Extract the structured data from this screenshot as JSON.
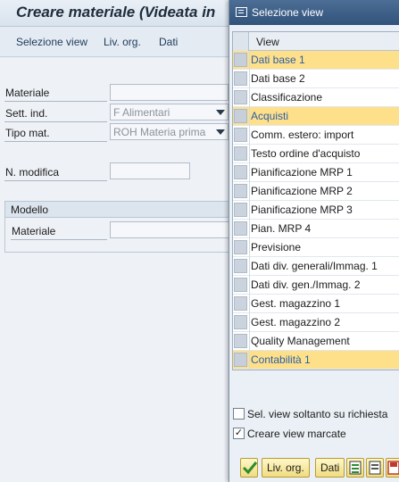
{
  "window": {
    "title": "Creare materiale (Videata in"
  },
  "menu": {
    "items": [
      "Selezione view",
      "Liv. org.",
      "Dati"
    ]
  },
  "form": {
    "materiale_label": "Materiale",
    "materiale_value": "",
    "sett_ind_label": "Sett. ind.",
    "sett_ind_value": "F Alimentari",
    "tipo_mat_label": "Tipo mat.",
    "tipo_mat_value": "ROH Materia prima",
    "n_modifica_label": "N. modifica",
    "n_modifica_value": ""
  },
  "modello": {
    "header": "Modello",
    "materiale_label": "Materiale",
    "materiale_value": ""
  },
  "dialog": {
    "title": "Selezione view",
    "column_header": "View",
    "rows": [
      {
        "label": "Dati base 1",
        "highlighted": true
      },
      {
        "label": "Dati base 2",
        "highlighted": false
      },
      {
        "label": "Classificazione",
        "highlighted": false
      },
      {
        "label": "Acquisti",
        "highlighted": true
      },
      {
        "label": "Comm. estero: import",
        "highlighted": false
      },
      {
        "label": "Testo ordine d'acquisto",
        "highlighted": false
      },
      {
        "label": "Pianificazione MRP 1",
        "highlighted": false
      },
      {
        "label": "Pianificazione MRP 2",
        "highlighted": false
      },
      {
        "label": "Pianificazione MRP 3",
        "highlighted": false
      },
      {
        "label": "Pian. MRP 4",
        "highlighted": false
      },
      {
        "label": "Previsione",
        "highlighted": false
      },
      {
        "label": "Dati div. generali/Immag. 1",
        "highlighted": false
      },
      {
        "label": "Dati div. gen./Immag. 2",
        "highlighted": false
      },
      {
        "label": "Gest. magazzino 1",
        "highlighted": false
      },
      {
        "label": "Gest. magazzino 2",
        "highlighted": false
      },
      {
        "label": "Quality Management",
        "highlighted": false
      },
      {
        "label": "Contabilità 1",
        "highlighted": true
      }
    ],
    "option_1_label": "Sel. view soltanto su richiesta",
    "option_1_checked": false,
    "option_2_label": "Creare view marcate",
    "option_2_checked": true,
    "btn_liv_org": "Liv. org.",
    "btn_dati": "Dati"
  },
  "colors": {
    "highlight": "#ffe08a",
    "title_bar": "#3b5d86"
  }
}
